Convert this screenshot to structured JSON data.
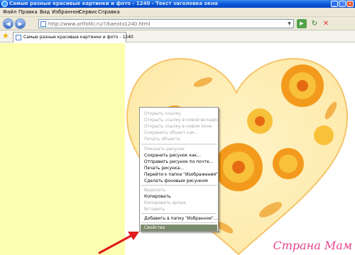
{
  "window": {
    "title": "Самые разные красивые картинки и фото - 1240 - Текст заголовка окна",
    "min_label": "_",
    "max_label": "□",
    "close_label": "x"
  },
  "menu": [
    "Файл",
    "Правка",
    "Вид",
    "Избранное",
    "Сервис",
    "Справка"
  ],
  "address": {
    "url": "http://www.artfotki.ru/?/kaeota1240.html",
    "back_glyph": "◀",
    "forward_glyph": "▶",
    "go_glyph": "▶",
    "refresh_glyph": "↻",
    "stop_glyph": "✕",
    "dropdown_glyph": "▼"
  },
  "tab": {
    "star_glyph": "★",
    "label": "Самые разные красивые картинки и фото - 1240"
  },
  "context_menu": {
    "groups": [
      [
        {
          "label": "Открыть ссылку",
          "enabled": false
        },
        {
          "label": "Открыть ссылку в новой вкладке",
          "enabled": false
        },
        {
          "label": "Открыть ссылку в новом окне",
          "enabled": false
        },
        {
          "label": "Сохранить объект как...",
          "enabled": false
        },
        {
          "label": "Печать объекта",
          "enabled": false
        }
      ],
      [
        {
          "label": "Показать рисунок",
          "enabled": false
        },
        {
          "label": "Сохранить рисунок как...",
          "enabled": true
        },
        {
          "label": "Отправить рисунок по почте...",
          "enabled": true
        },
        {
          "label": "Печать рисунка...",
          "enabled": true
        },
        {
          "label": "Перейти к папке \"Изображения\"",
          "enabled": true
        },
        {
          "label": "Сделать фоновым рисунком",
          "enabled": true
        }
      ],
      [
        {
          "label": "Вырезать",
          "enabled": false
        },
        {
          "label": "Копировать",
          "enabled": true
        },
        {
          "label": "Копировать ярлык",
          "enabled": false
        },
        {
          "label": "Вставить",
          "enabled": false
        }
      ],
      [
        {
          "label": "Добавить в папку \"Избранное\"...",
          "enabled": true
        }
      ]
    ],
    "highlighted": "Свойства"
  },
  "watermark": "Страна Мам",
  "colors": {
    "left_panel": "#fefeb0",
    "arrow": "#e01b1b",
    "highlight": "#7b8b6e"
  }
}
